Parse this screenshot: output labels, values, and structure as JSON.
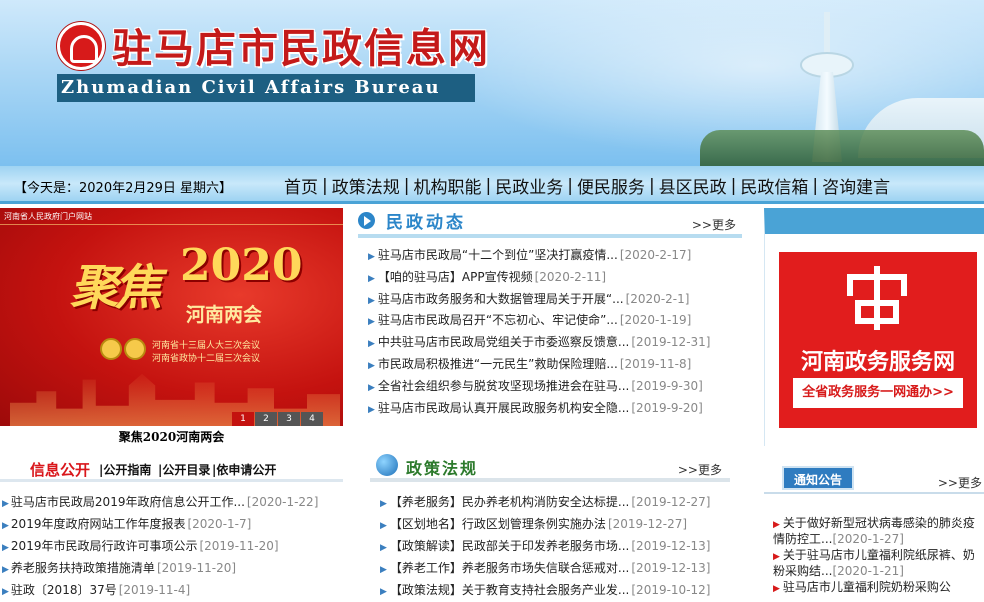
{
  "header": {
    "site_title": "驻马店市民政信息网",
    "site_title_en": "Zhumadian Civil Affairs Bureau"
  },
  "navbar": {
    "date": "【今天是：2020年2月29日 星期六】",
    "items": [
      "首页",
      "政策法规",
      "机构职能",
      "民政业务",
      "便民服务",
      "县区民政",
      "民政信箱",
      "咨询建言"
    ]
  },
  "slideshow": {
    "tag": "河南省人民政府门户网站",
    "title_big": "2020",
    "title_calli": "聚焦",
    "subtitle": "河南两会",
    "line1": "河南省十三届人大三次会议",
    "line2": "河南省政协十二届三次会议",
    "pages": [
      "1",
      "2",
      "3",
      "4"
    ],
    "active_page": 1,
    "caption": "聚焦2020河南两会"
  },
  "info_public": {
    "title": "信息公开",
    "links": [
      "|公开指南",
      "|公开目录",
      "|依申请公开"
    ],
    "items": [
      {
        "text": "驻马店市民政局2019年政府信息公开工作...",
        "date": "[2020-1-22]"
      },
      {
        "text": "2019年度政府网站工作年度报表",
        "date": "[2020-1-7]"
      },
      {
        "text": "2019年市民政局行政许可事项公示",
        "date": "[2019-11-20]"
      },
      {
        "text": "养老服务扶持政策措施清单",
        "date": "[2019-11-20]"
      },
      {
        "text": "驻政〔2018〕37号",
        "date": "[2019-11-4]"
      }
    ]
  },
  "news": {
    "title": "民政动态",
    "more": ">>更多",
    "items": [
      {
        "text": "驻马店市民政局“十二个到位”坚决打赢疫情...",
        "date": "[2020-2-17]"
      },
      {
        "text": "【咱的驻马店】APP宣传视频",
        "date": "[2020-2-11]"
      },
      {
        "text": "驻马店市政务服务和大数据管理局关于开展“...",
        "date": "[2020-2-1]"
      },
      {
        "text": "驻马店市民政局召开“不忘初心、牢记使命”...",
        "date": "[2020-1-19]"
      },
      {
        "text": "中共驻马店市民政局党组关于市委巡察反馈意...",
        "date": "[2019-12-31]"
      },
      {
        "text": "市民政局积极推进“一元民生”救助保险理赔...",
        "date": "[2019-11-8]"
      },
      {
        "text": "全省社会组织参与脱贫攻坚现场推进会在驻马...",
        "date": "[2019-9-30]"
      },
      {
        "text": "驻马店市民政局认真开展民政服务机构安全隐...",
        "date": "[2019-9-20]"
      }
    ]
  },
  "policy": {
    "title": "政策法规",
    "more": ">>更多",
    "items": [
      {
        "text": "【养老服务】民办养老机构消防安全达标提...",
        "date": "[2019-12-27]"
      },
      {
        "text": "【区划地名】行政区划管理条例实施办法",
        "date": "[2019-12-27]"
      },
      {
        "text": "【政策解读】民政部关于印发养老服务市场...",
        "date": "[2019-12-13]"
      },
      {
        "text": "【养老工作】养老服务市场失信联合惩戒对...",
        "date": "[2019-12-13]"
      },
      {
        "text": "【政策法规】关于教育支持社会服务产业发...",
        "date": "[2019-10-12]"
      }
    ]
  },
  "gov_service": {
    "name": "河南政务服务网",
    "button": "全省政务服务一网通办>>"
  },
  "notice": {
    "title": "通知公告",
    "more": ">>更多",
    "items": [
      {
        "text": "关于做好新型冠状病毒感染的肺炎疫情防控工...",
        "date": "[2020-1-27]"
      },
      {
        "text": "关于驻马店市儿童福利院纸尿裤、奶粉采购结...",
        "date": "[2020-1-21]"
      },
      {
        "text": "驻马店市儿童福利院奶粉采购公",
        "date": ""
      }
    ]
  }
}
